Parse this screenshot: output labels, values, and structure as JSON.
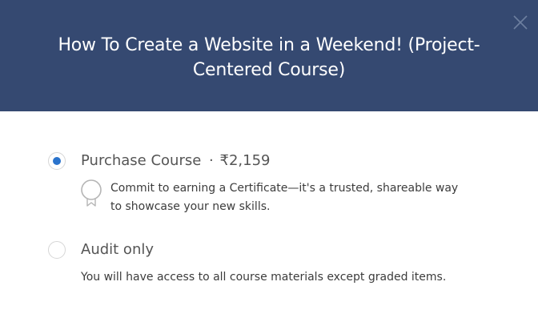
{
  "modal": {
    "title": "How To Create a Website in a Weekend! (Project-Centered Course)",
    "close_icon": "close-icon"
  },
  "options": {
    "purchase": {
      "label": "Purchase Course",
      "separator": "·",
      "price": "₹2,159",
      "selected": true,
      "description": "Commit to earning a Certificate—it's a trusted, shareable way to showcase your new skills.",
      "icon": "certificate-ribbon-icon"
    },
    "audit": {
      "label": "Audit only",
      "selected": false,
      "description": "You will have access to all course materials except graded items."
    }
  },
  "colors": {
    "header_bg": "#354971",
    "radio_selected": "#2a73cc",
    "text": "#555555"
  }
}
